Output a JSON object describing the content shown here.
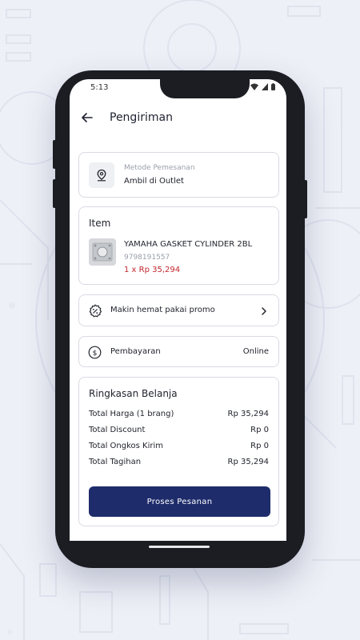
{
  "status": {
    "time": "5:13"
  },
  "header": {
    "title": "Pengiriman"
  },
  "order_method": {
    "label": "Metode Pemesanan",
    "value": "Ambil di Outlet"
  },
  "item_section": {
    "title": "Item",
    "product_name": "YAMAHA GASKET CYLINDER 2BL",
    "sku": "9798191557",
    "qty_price": "1 x Rp 35,294"
  },
  "promo": {
    "label": "Makin hemat pakai promo"
  },
  "payment": {
    "label": "Pembayaran",
    "value": "Online"
  },
  "summary": {
    "title": "Ringkasan Belanja",
    "rows": [
      {
        "label": "Total Harga (1 brang)",
        "value": "Rp 35,294"
      },
      {
        "label": "Total Discount",
        "value": "Rp 0"
      },
      {
        "label": "Total Ongkos Kirim",
        "value": "Rp 0"
      },
      {
        "label": "Total Tagihan",
        "value": "Rp 35,294"
      }
    ],
    "cta_label": "Proses Pesanan"
  },
  "colors": {
    "primary": "#1e2c6b",
    "price": "#c2262e",
    "background": "#eef0f7"
  }
}
